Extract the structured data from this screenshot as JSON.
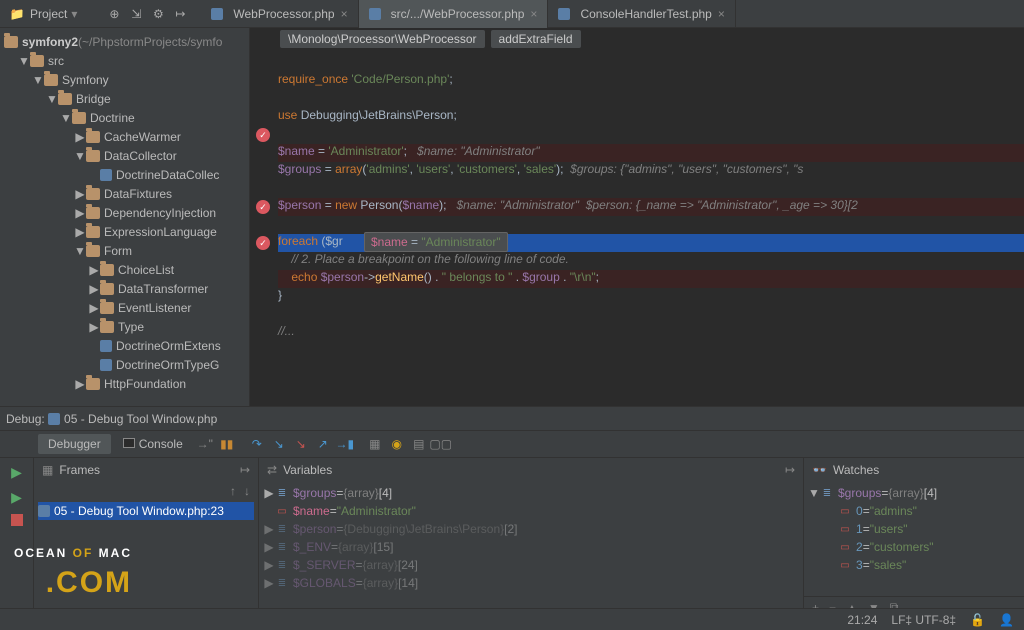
{
  "toolbar": {
    "project_label": "Project"
  },
  "tabs": [
    {
      "icon": "php-file-icon",
      "label": "WebProcessor.php",
      "active": false
    },
    {
      "icon": "php-file-icon",
      "label": "src/.../WebProcessor.php",
      "active": true
    },
    {
      "icon": "php-file-icon",
      "label": "ConsoleHandlerTest.php",
      "active": false
    }
  ],
  "tree": {
    "root": {
      "name": "symfony2",
      "path": " (~/PhpstormProjects/symfo"
    },
    "nodes": [
      {
        "depth": 1,
        "arrow": "▼",
        "type": "folder",
        "label": "src"
      },
      {
        "depth": 2,
        "arrow": "▼",
        "type": "folder",
        "label": "Symfony"
      },
      {
        "depth": 3,
        "arrow": "▼",
        "type": "folder",
        "label": "Bridge"
      },
      {
        "depth": 4,
        "arrow": "▼",
        "type": "folder",
        "label": "Doctrine"
      },
      {
        "depth": 5,
        "arrow": "▶",
        "type": "folder",
        "label": "CacheWarmer"
      },
      {
        "depth": 5,
        "arrow": "▼",
        "type": "folder",
        "label": "DataCollector"
      },
      {
        "depth": 6,
        "arrow": "",
        "type": "php",
        "label": "DoctrineDataCollec"
      },
      {
        "depth": 5,
        "arrow": "▶",
        "type": "folder",
        "label": "DataFixtures"
      },
      {
        "depth": 5,
        "arrow": "▶",
        "type": "folder",
        "label": "DependencyInjection"
      },
      {
        "depth": 5,
        "arrow": "▶",
        "type": "folder",
        "label": "ExpressionLanguage"
      },
      {
        "depth": 5,
        "arrow": "▼",
        "type": "folder",
        "label": "Form"
      },
      {
        "depth": 6,
        "arrow": "▶",
        "type": "folder",
        "label": "ChoiceList"
      },
      {
        "depth": 6,
        "arrow": "▶",
        "type": "folder",
        "label": "DataTransformer"
      },
      {
        "depth": 6,
        "arrow": "▶",
        "type": "folder",
        "label": "EventListener"
      },
      {
        "depth": 6,
        "arrow": "▶",
        "type": "folder",
        "label": "Type"
      },
      {
        "depth": 6,
        "arrow": "",
        "type": "php",
        "label": "DoctrineOrmExtens"
      },
      {
        "depth": 6,
        "arrow": "",
        "type": "php",
        "label": "DoctrineOrmTypeG"
      },
      {
        "depth": 5,
        "arrow": "▶",
        "type": "folder",
        "label": "HttpFoundation"
      }
    ]
  },
  "breadcrumbs": [
    "\\Monolog\\Processor\\WebProcessor",
    "addExtraField"
  ],
  "code": {
    "l1a": "require_once ",
    "l1b": "'Code/Person.php'",
    "l1c": ";",
    "l2a": "use ",
    "l2b": "Debugging\\JetBrains\\Person;",
    "l3a": "$name",
    "l3b": " = ",
    "l3c": "'Administrator'",
    "l3d": ";   ",
    "l3e": "$name: \"Administrator\"",
    "l4a": "$groups",
    "l4b": " = ",
    "l4c": "array",
    "l4d": "(",
    "l4e": "'admins'",
    "l4f": ", ",
    "l4g": "'users'",
    "l4h": ", ",
    "l4i": "'customers'",
    "l4j": ", ",
    "l4k": "'sales'",
    "l4l": ");  ",
    "l4m": "$groups: {\"admins\", \"users\", \"customers\", \"s",
    "l5a": "$person",
    "l5b": " = ",
    "l5c": "new ",
    "l5d": "Person",
    "l5e": "(",
    "l5f": "$name",
    "l5g": ");   ",
    "l5h": "$name: \"Administrator\"  $person: {_name => \"Administrator\", _age => 30}[2",
    "l6a": "foreach ",
    "l6b": "($gr",
    "tip_var": "$name",
    "tip_eq": " = ",
    "tip_val": "\"Administrator\"",
    "l7a": "    // 2. Pl",
    "l7b": "ace a breakpoint on the following line of code.",
    "l8a": "    ",
    "l8b": "echo ",
    "l8c": "$person",
    "l8d": "->",
    "l8e": "getName",
    "l8f": "() . ",
    "l8g": "\" belongs to \"",
    "l8h": " . ",
    "l8i": "$group",
    "l8j": " . ",
    "l8k": "\"\\r\\n\"",
    "l8l": ";",
    "l9": "}",
    "l10": "//..."
  },
  "debug": {
    "title": "Debug:",
    "file": "05 - Debug Tool Window.php"
  },
  "debugger": {
    "tab_debugger": "Debugger",
    "tab_console": "Console"
  },
  "frames": {
    "title": "Frames",
    "selected": "05 - Debug Tool Window.php:23"
  },
  "variables": {
    "title": "Variables",
    "items": [
      {
        "exp": "▶",
        "icon": "≣",
        "name": "$groups",
        "eq": " = ",
        "type": "{array}",
        "extra": " [4]",
        "sel": false,
        "dim": false,
        "color": "#6b8fb3"
      },
      {
        "exp": "",
        "icon": "▭",
        "name": "$name",
        "eq": " = ",
        "val": "\"Administrator\"",
        "sel": true,
        "dim": false,
        "color": "#c75450"
      },
      {
        "exp": "▶",
        "icon": "≣",
        "name": "$person",
        "eq": " = ",
        "type": "{Debugging\\JetBrains\\Person}",
        "extra": " [2]",
        "dim": true,
        "color": "#6b8fb3"
      },
      {
        "exp": "▶",
        "icon": "≣",
        "name": "$_ENV",
        "eq": " = ",
        "type": "{array}",
        "extra": " [15]",
        "dim": true,
        "color": "#6b8fb3"
      },
      {
        "exp": "▶",
        "icon": "≣",
        "name": "$_SERVER",
        "eq": " = ",
        "type": "{array}",
        "extra": " [24]",
        "dim": true,
        "color": "#6b8fb3"
      },
      {
        "exp": "▶",
        "icon": "≣",
        "name": "$GLOBALS",
        "eq": " = ",
        "type": "{array}",
        "extra": " [14]",
        "dim": true,
        "color": "#6b8fb3"
      }
    ]
  },
  "watches": {
    "title": "Watches",
    "root": {
      "exp": "▼",
      "icon": "≣",
      "name": "$groups",
      "eq": " = ",
      "type": "{array}",
      "extra": " [4]"
    },
    "items": [
      {
        "icon": "▭",
        "name": "0",
        "eq": " = ",
        "val": "\"admins\""
      },
      {
        "icon": "▭",
        "name": "1",
        "eq": " = ",
        "val": "\"users\""
      },
      {
        "icon": "▭",
        "name": "2",
        "eq": " = ",
        "val": "\"customers\""
      },
      {
        "icon": "▭",
        "name": "3",
        "eq": " = ",
        "val": "\"sales\""
      }
    ]
  },
  "status": {
    "pos": "21:24",
    "enc": "LF‡   UTF-8‡",
    "lock": "🔓"
  },
  "logo": {
    "a": "OCEAN ",
    "b": "OF",
    "c": " MAC",
    "d": ".COM"
  }
}
